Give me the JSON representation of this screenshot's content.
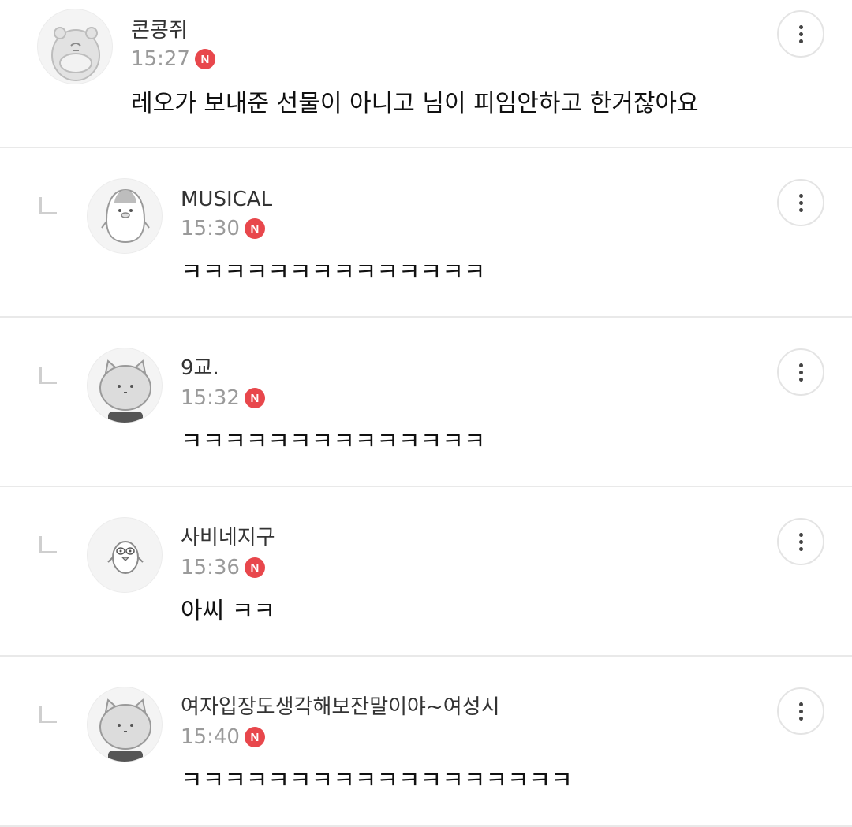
{
  "comments": [
    {
      "nickname": "콘콩쥐",
      "time": "15:27",
      "badge": "N",
      "text": "레오가 보내준 선물이 아니고 님이 피임안하고 한거잖아요",
      "avatar": "hamster-avatar-icon",
      "is_reply": false
    },
    {
      "nickname": "MUSICAL",
      "time": "15:30",
      "badge": "N",
      "text": "ㅋㅋㅋㅋㅋㅋㅋㅋㅋㅋㅋㅋㅋㅋ",
      "avatar": "penguin-avatar-icon",
      "is_reply": true
    },
    {
      "nickname": "9교.",
      "time": "15:32",
      "badge": "N",
      "text": "ㅋㅋㅋㅋㅋㅋㅋㅋㅋㅋㅋㅋㅋㅋ",
      "avatar": "cat-avatar-icon",
      "is_reply": true
    },
    {
      "nickname": "사비네지구",
      "time": "15:36",
      "badge": "N",
      "text": "아씨 ㅋㅋ",
      "avatar": "bird-avatar-icon",
      "is_reply": true
    },
    {
      "nickname": "여자입장도생각해보잔말이야~여성시",
      "time": "15:40",
      "badge": "N",
      "text": "ㅋㅋㅋㅋㅋㅋㅋㅋㅋㅋㅋㅋㅋㅋㅋㅋㅋㅋ",
      "avatar": "cat-avatar-icon",
      "is_reply": true
    }
  ],
  "colors": {
    "badge": "#e8474c",
    "time": "#9a9a9a",
    "divider": "#e9e9e9"
  }
}
